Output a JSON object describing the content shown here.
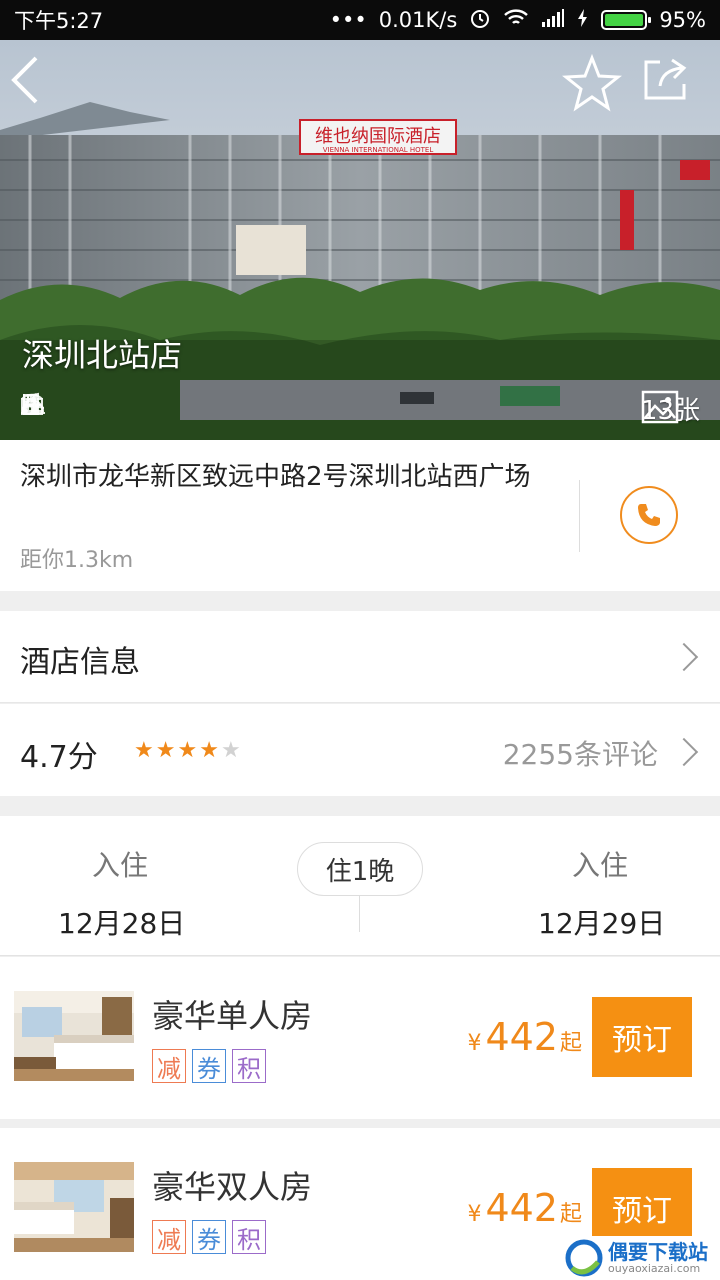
{
  "status_bar": {
    "time": "下午5:27",
    "dots": "•••",
    "net_speed": "0.01K/s",
    "battery": "95%"
  },
  "hero": {
    "hotel_name": "深圳北站店",
    "photo_count": "13张",
    "building_sign": "维也纳国际酒店",
    "building_sign_en": "VIENNA INTERNATIONAL HOTEL",
    "amenity_icons": [
      "wifi-icon",
      "restaurant-icon",
      "parking-icon",
      "laundry-icon",
      "luggage-icon",
      "music-icon",
      "service-bell-icon",
      "airport-icon"
    ]
  },
  "address": {
    "text": "深圳市龙华新区致远中路2号深圳北站西广场",
    "distance": "距你1.3km"
  },
  "hotel_info": {
    "label": "酒店信息"
  },
  "rating": {
    "score": "4.7分",
    "stars": 4,
    "reviews": "2255条评论"
  },
  "stay": {
    "checkin_label": "入住",
    "checkin_date": "12月28日",
    "nights": "住1晚",
    "checkout_label": "入住",
    "checkout_date": "12月29日"
  },
  "rooms": [
    {
      "name": "豪华单人房",
      "tags": [
        "减",
        "券",
        "积"
      ],
      "currency": "¥",
      "price": "442",
      "suffix": "起",
      "book_label": "预订"
    },
    {
      "name": "豪华双人房",
      "tags": [
        "减",
        "券",
        "积"
      ],
      "currency": "¥",
      "price": "442",
      "suffix": "起",
      "book_label": "预订"
    }
  ],
  "watermark": {
    "title": "偶要下载站",
    "subtitle": "ouyaoxiazai.com"
  },
  "colors": {
    "accent": "#f59012",
    "price": "#f0891a",
    "tag_reduce": "#ee7a52",
    "tag_coupon": "#4a8cd8",
    "tag_points": "#9b6bc9"
  }
}
